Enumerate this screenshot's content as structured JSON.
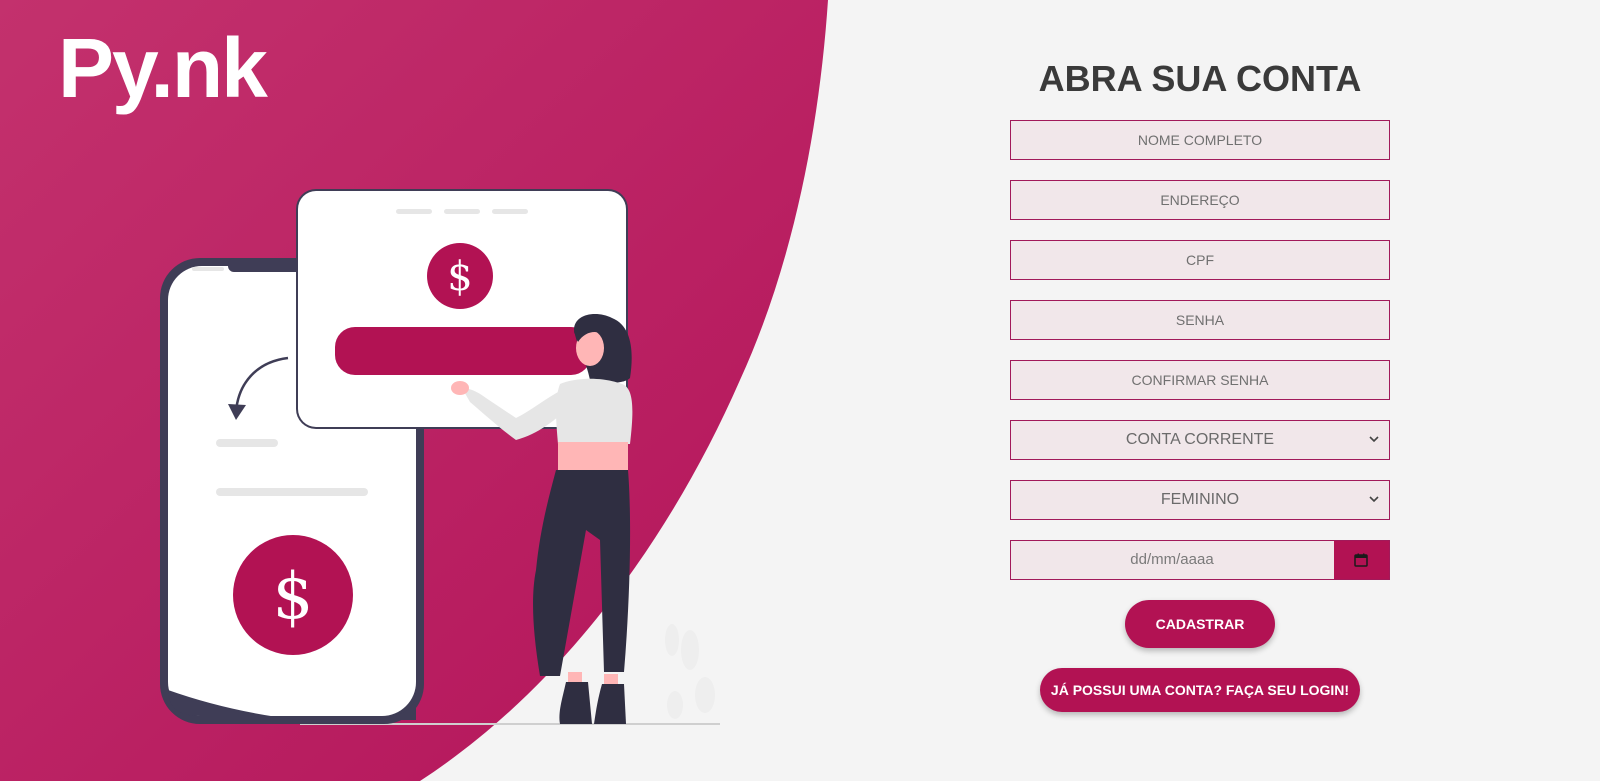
{
  "brand": {
    "logo_text": "Py.nk",
    "primary_color": "#b21253",
    "background_gradient": [
      "#c02e6b",
      "#b5165a"
    ]
  },
  "form": {
    "title": "ABRA SUA CONTA",
    "fields": {
      "full_name": {
        "placeholder": "NOME COMPLETO",
        "value": ""
      },
      "address": {
        "placeholder": "ENDEREÇO",
        "value": ""
      },
      "cpf": {
        "placeholder": "CPF",
        "value": ""
      },
      "password": {
        "placeholder": "SENHA",
        "value": ""
      },
      "confirm_password": {
        "placeholder": "CONFIRMAR SENHA",
        "value": ""
      }
    },
    "account_type": {
      "selected": "CONTA CORRENTE"
    },
    "gender": {
      "selected": "FEMININO"
    },
    "birth_date": {
      "placeholder": "dd/mm/aaaa"
    },
    "register_button": "CADASTRAR",
    "login_button": "JÁ POSSUI UMA CONTA? FAÇA SEU LOGIN!"
  },
  "illustration": {
    "icons": [
      "phone-icon",
      "card-window-icon",
      "dollar-icon",
      "arrow-icon",
      "woman-figure"
    ]
  }
}
